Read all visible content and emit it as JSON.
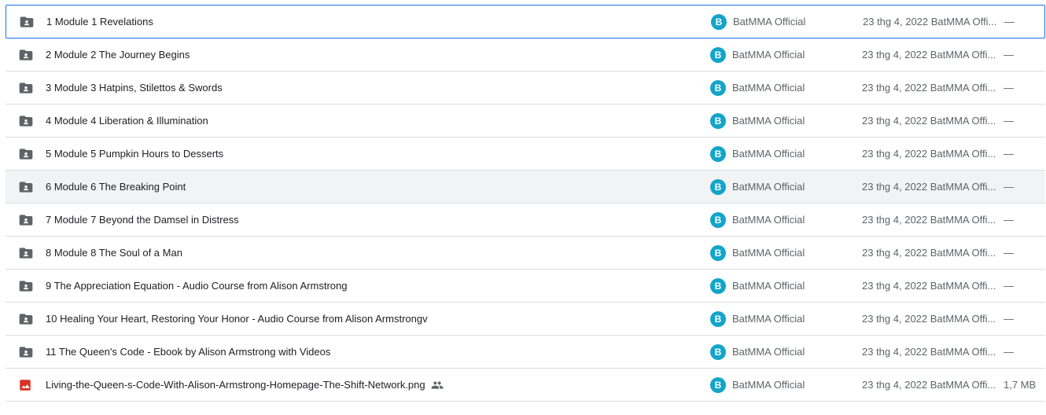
{
  "rows": [
    {
      "name": "1 Module 1 Revelations",
      "owner": "BatMMA Official",
      "avatar_letter": "B",
      "modified": "23 thg 4, 2022 BatMMA Offi...",
      "size": "—",
      "type": "shared-folder"
    },
    {
      "name": "2 Module 2 The Journey Begins",
      "owner": "BatMMA Official",
      "avatar_letter": "B",
      "modified": "23 thg 4, 2022 BatMMA Offi...",
      "size": "—",
      "type": "shared-folder"
    },
    {
      "name": "3 Module 3 Hatpins, Stilettos & Swords",
      "owner": "BatMMA Official",
      "avatar_letter": "B",
      "modified": "23 thg 4, 2022 BatMMA Offi...",
      "size": "—",
      "type": "shared-folder"
    },
    {
      "name": "4 Module 4 Liberation & Illumination",
      "owner": "BatMMA Official",
      "avatar_letter": "B",
      "modified": "23 thg 4, 2022 BatMMA Offi...",
      "size": "—",
      "type": "shared-folder"
    },
    {
      "name": "5 Module 5 Pumpkin Hours to Desserts",
      "owner": "BatMMA Official",
      "avatar_letter": "B",
      "modified": "23 thg 4, 2022 BatMMA Offi...",
      "size": "—",
      "type": "shared-folder"
    },
    {
      "name": "6 Module 6 The Breaking Point",
      "owner": "BatMMA Official",
      "avatar_letter": "B",
      "modified": "23 thg 4, 2022 BatMMA Offi...",
      "size": "—",
      "type": "shared-folder"
    },
    {
      "name": "7 Module 7 Beyond the Damsel in Distress",
      "owner": "BatMMA Official",
      "avatar_letter": "B",
      "modified": "23 thg 4, 2022 BatMMA Offi...",
      "size": "—",
      "type": "shared-folder"
    },
    {
      "name": "8 Module 8 The Soul of a Man",
      "owner": "BatMMA Official",
      "avatar_letter": "B",
      "modified": "23 thg 4, 2022 BatMMA Offi...",
      "size": "—",
      "type": "shared-folder"
    },
    {
      "name": "9 The Appreciation Equation - Audio Course from Alison Armstrong",
      "owner": "BatMMA Official",
      "avatar_letter": "B",
      "modified": "23 thg 4, 2022 BatMMA Offi...",
      "size": "—",
      "type": "shared-folder"
    },
    {
      "name": "10 Healing Your Heart, Restoring Your Honor - Audio Course from Alison Armstrongv",
      "owner": "BatMMA Official",
      "avatar_letter": "B",
      "modified": "23 thg 4, 2022 BatMMA Offi...",
      "size": "—",
      "type": "shared-folder"
    },
    {
      "name": "11 The Queen's Code - Ebook by Alison Armstrong with Videos",
      "owner": "BatMMA Official",
      "avatar_letter": "B",
      "modified": "23 thg 4, 2022 BatMMA Offi...",
      "size": "—",
      "type": "shared-folder"
    },
    {
      "name": "Living-the-Queen-s-Code-With-Alison-Armstrong-Homepage-The-Shift-Network.png",
      "owner": "BatMMA Official",
      "avatar_letter": "B",
      "modified": "23 thg 4, 2022 BatMMA Offi...",
      "size": "1,7 MB",
      "type": "image-file",
      "shared": true
    }
  ],
  "selected_row": 0,
  "hover_row": 5,
  "colors": {
    "accent": "#1a73e8",
    "avatar": "#12a5c9",
    "image_icon": "#d93025",
    "folder_icon": "#5f6368"
  },
  "icons": {
    "folder": "shared-folder-icon",
    "image": "image-file-icon",
    "shared": "people-icon"
  }
}
